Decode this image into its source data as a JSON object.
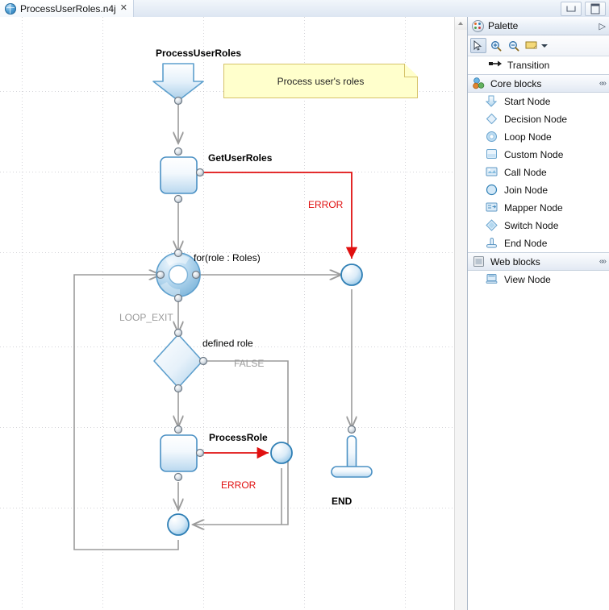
{
  "window": {
    "minimize_label": "Minimize",
    "maximize_label": "Maximize"
  },
  "tab": {
    "title": "ProcessUserRoles.n4j",
    "close_glyph": "✕",
    "icon": "diagram-file-icon"
  },
  "palette": {
    "title": "Palette",
    "collapse_glyph": "▷",
    "toolbar": [
      {
        "name": "select-tool",
        "glyph": "↖",
        "pressed": true
      },
      {
        "name": "zoom-in-tool",
        "glyph": "+",
        "pressed": false
      },
      {
        "name": "zoom-out-tool",
        "glyph": "−",
        "pressed": false
      },
      {
        "name": "note-tool",
        "glyph": "note",
        "pressed": false
      }
    ],
    "transition": {
      "label": "Transition",
      "icon": "transition-arrow-icon"
    },
    "sections": [
      {
        "name": "Core blocks",
        "icon": "core-blocks-icon",
        "chevron": "«»",
        "items": [
          {
            "label": "Start Node",
            "icon": "start-node-icon"
          },
          {
            "label": "Decision Node",
            "icon": "decision-node-icon"
          },
          {
            "label": "Loop Node",
            "icon": "loop-node-icon"
          },
          {
            "label": "Custom Node",
            "icon": "custom-node-icon"
          },
          {
            "label": "Call Node",
            "icon": "call-node-icon"
          },
          {
            "label": "Join Node",
            "icon": "join-node-icon"
          },
          {
            "label": "Mapper Node",
            "icon": "mapper-node-icon"
          },
          {
            "label": "Switch Node",
            "icon": "switch-node-icon"
          },
          {
            "label": "End Node",
            "icon": "end-node-icon"
          }
        ]
      },
      {
        "name": "Web blocks",
        "icon": "web-blocks-icon",
        "chevron": "«»",
        "items": [
          {
            "label": "View Node",
            "icon": "view-node-icon"
          }
        ]
      }
    ]
  },
  "diagram": {
    "note": {
      "text": "Process user's roles"
    },
    "nodes": [
      {
        "id": "start",
        "type": "start",
        "label": "ProcessUserRoles"
      },
      {
        "id": "getroles",
        "type": "custom",
        "label": "GetUserRoles"
      },
      {
        "id": "loop",
        "type": "loop",
        "label": "for(role : Roles)"
      },
      {
        "id": "join_err1",
        "type": "join",
        "label": ""
      },
      {
        "id": "decision",
        "type": "decision",
        "label": "defined role"
      },
      {
        "id": "processrole",
        "type": "custom",
        "label": "ProcessRole"
      },
      {
        "id": "join_err2",
        "type": "join",
        "label": ""
      },
      {
        "id": "join_bot",
        "type": "join",
        "label": ""
      },
      {
        "id": "end",
        "type": "end",
        "label": "END"
      }
    ],
    "edges": [
      {
        "from": "getroles",
        "to": "join_err1",
        "label": "ERROR",
        "kind": "error"
      },
      {
        "from": "loop",
        "to": "decision",
        "label": "LOOP_EXIT",
        "kind": "normal"
      },
      {
        "from": "decision",
        "to": "join_bot",
        "label": "FALSE",
        "kind": "normal"
      },
      {
        "from": "processrole",
        "to": "join_err2",
        "label": "ERROR",
        "kind": "error"
      }
    ],
    "colors": {
      "error": "#e01010",
      "normal": "#9b9b9b",
      "node_border": "#4a90c4",
      "note_bg": "#ffffcc"
    }
  }
}
